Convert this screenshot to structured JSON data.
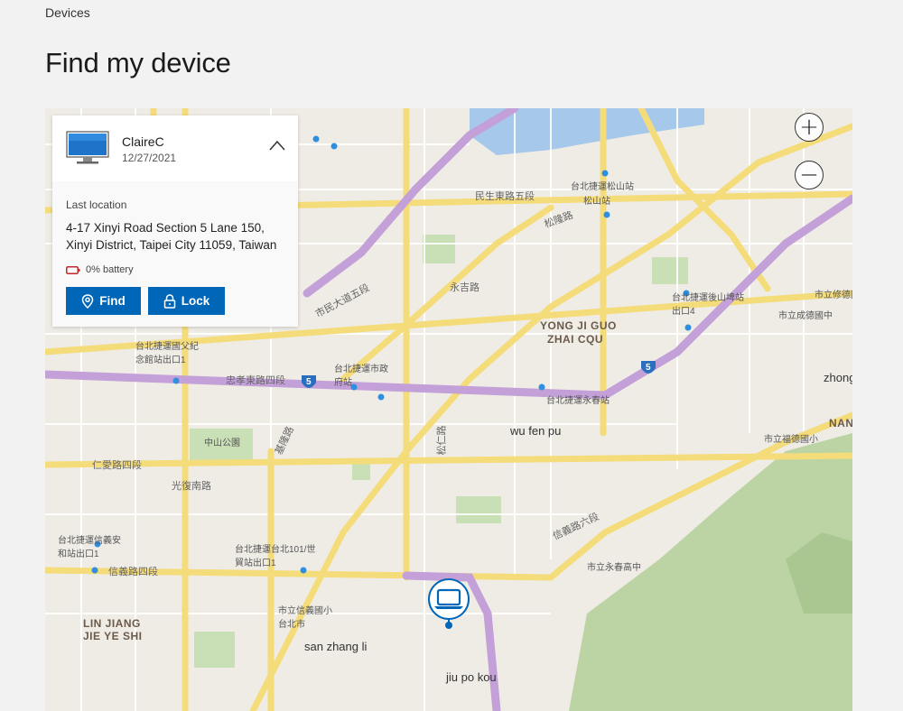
{
  "breadcrumb": "Devices",
  "page_title": "Find my device",
  "device": {
    "name": "ClaireC",
    "date": "12/27/2021",
    "last_location_label": "Last location",
    "address_line1": "4-17 Xinyi Road Section 5 Lane 150,",
    "address_line2": "Xinyi District, Taipei City 11059, Taiwan",
    "battery": "0% battery",
    "battery_level": 0
  },
  "actions": {
    "find_label": "Find",
    "lock_label": "Lock"
  },
  "zoom": {
    "in_symbol": "+",
    "out_symbol": "−"
  },
  "map_labels": {
    "yong_ji_1": "YONG JI GUO",
    "yong_ji_2": "ZHAI CQU",
    "lin_jiang_1": "LIN JIANG",
    "lin_jiang_2": "JIE YE SHI",
    "wu_fen_pu": "wu fen pu",
    "san_zhang_li": "san zhang li",
    "jiu_po_kou": "jiu po kou",
    "zhong": "zhong",
    "nan": "NAN",
    "minsheng": "民生東路五段",
    "civic": "市民大道五段",
    "zhongxiao": "忠孝東路四段",
    "renai": "仁愛路四段",
    "xinyi": "信義路四段",
    "xinyi6": "信義路六段",
    "yongji": "永吉路",
    "songlong": "松隆路",
    "songren": "松仁路",
    "guangfu": "光復南路",
    "jilong": "基隆路",
    "songshan": "松山站",
    "songshan_mrt": "台北捷運松山站",
    "houshanpi": "台北捷運後山埤站出口4",
    "yongchun": "台北捷運永春站",
    "citygov": "台北捷運市政府站",
    "sysm": "台北捷運國父紀念館站出口1",
    "taipei101": "台北捷運台北101/世貿站出口1",
    "xinyi_anhe": "台北捷運信義安和站出口1",
    "zhongshan_park": "中山公園",
    "taipei_city": "市立信義國小 台北市",
    "yongchun_high": "市立永春高中",
    "chengde": "市立成德國中",
    "fude": "市立福德國小",
    "xiuxiu": "市立修德國小",
    "route5": "5"
  }
}
